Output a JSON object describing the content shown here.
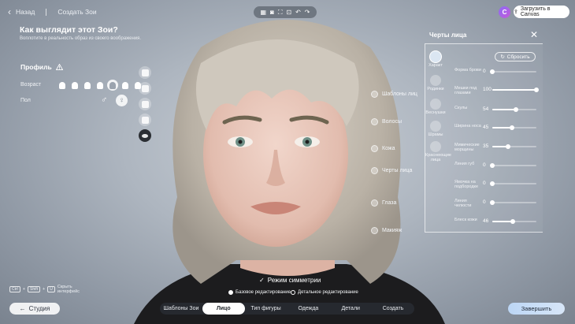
{
  "topbar": {
    "back_label": "Назад",
    "breadcrumb": "Создать Зои",
    "toolbar_icons": [
      "grid-icon",
      "camera-icon",
      "crop-icon",
      "eye-frame-icon",
      "undo-icon",
      "redo-icon"
    ],
    "account_initial": "C",
    "upload_label": "Загрузить в Canvas"
  },
  "header": {
    "title": "Как выглядит этот Зои?",
    "subtitle": "Воплотите в реальность образ из своего воображения."
  },
  "profile": {
    "title": "Профиль",
    "age_label": "Возраст",
    "sex_label": "Пол",
    "male_symbol": "♂",
    "female_symbol": "♀"
  },
  "categories": [
    {
      "label": "Шаблоны лиц"
    },
    {
      "label": "Волосы"
    },
    {
      "label": "Кожа"
    },
    {
      "label": "Черты лица"
    },
    {
      "label": "Глаза"
    },
    {
      "label": "Макияж"
    }
  ],
  "panel": {
    "title": "Черты лица",
    "reset_label": "Сбросить",
    "features": [
      {
        "label": "Характ"
      },
      {
        "label": "Родинки"
      },
      {
        "label": "Веснушки"
      },
      {
        "label": "Шрамы"
      },
      {
        "label": "Краснеющие лица"
      }
    ],
    "sliders": [
      {
        "label": "Форма брови",
        "value": 0
      },
      {
        "label": "Мешки под глазами",
        "value": 100
      },
      {
        "label": "Скулы",
        "value": 54
      },
      {
        "label": "Ширина носа",
        "value": 45
      },
      {
        "label": "Мимические морщины",
        "value": 35
      },
      {
        "label": "Линия губ",
        "value": 0
      },
      {
        "label": "Ямочка на подбородке",
        "value": 0
      },
      {
        "label": "Линия челюсти",
        "value": 0
      },
      {
        "label": "Блеск кожи",
        "value": 46
      }
    ]
  },
  "bottom": {
    "kbd_ctrl": "Ctrl",
    "kbd_shift": "Shift",
    "kbd_u": "U",
    "hide_hint": "Скрыть интерфейс",
    "studio_label": "Студия",
    "symmetry_label": "Режим симметрии",
    "basic_edit": "Базовое редактирование",
    "detail_edit": "Детальное редактирование",
    "tabs": [
      "Шаблоны Зои",
      "Лицо",
      "Тип фигуры",
      "Одежда",
      "Детали",
      "Создать"
    ],
    "finish_label": "Завершить"
  },
  "colors": {
    "accent": "#bcd6f5",
    "background": "#aeb6c0",
    "panel_border": "#ffffff"
  }
}
